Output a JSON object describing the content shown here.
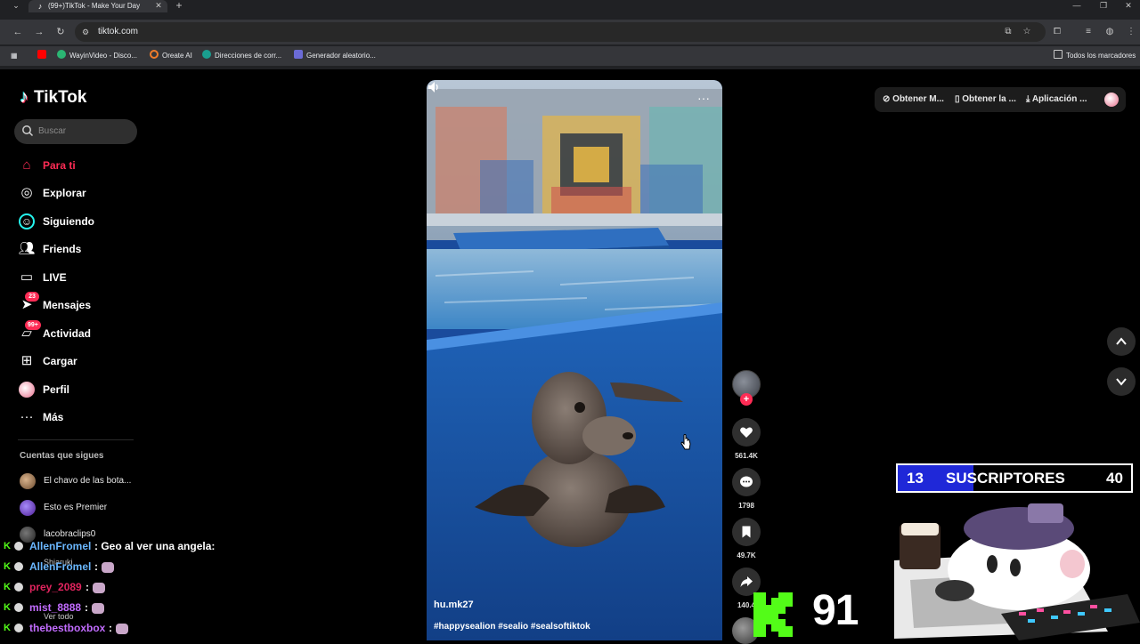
{
  "browser": {
    "tab_title": "(99+)TikTok - Make Your Day",
    "url": "tiktok.com",
    "bookmarks": [
      "WayinVideo - Disco...",
      "Oreate AI",
      "Direcciones de corr...",
      "Generador aleatorio..."
    ],
    "all_bookmarks": "Todos los marcadores"
  },
  "tiktok": {
    "logo": "TikTok",
    "search_placeholder": "Buscar",
    "nav": [
      {
        "label": "Para ti",
        "icon": "home-icon",
        "active": true
      },
      {
        "label": "Explorar",
        "icon": "compass-icon"
      },
      {
        "label": "Siguiendo",
        "icon": "following-icon"
      },
      {
        "label": "Friends",
        "icon": "friends-icon"
      },
      {
        "label": "LIVE",
        "icon": "live-icon"
      },
      {
        "label": "Mensajes",
        "icon": "messages-icon",
        "badge": "23"
      },
      {
        "label": "Actividad",
        "icon": "activity-icon",
        "badge": "99+"
      },
      {
        "label": "Cargar",
        "icon": "upload-icon"
      },
      {
        "label": "Perfil",
        "icon": "profile-icon"
      },
      {
        "label": "Más",
        "icon": "more-icon"
      }
    ],
    "following_title": "Cuentas que sigues",
    "following": [
      "El chavo de las bota...",
      "Esto es Premier",
      "lacobraclips0"
    ],
    "under_overlay": [
      "Shiaruki",
      "Ver todo"
    ],
    "video": {
      "author": "hu.mk27",
      "description": "#happysealion #sealio #sealsoftiktok"
    },
    "actions": {
      "likes": "561.4K",
      "comments": "1798",
      "saves": "49.7K",
      "shares": "140.4"
    },
    "top_actions": [
      "Obtener M...",
      "Obtener la ...",
      "Aplicación ..."
    ]
  },
  "stream": {
    "subs": {
      "current": "13",
      "label": "SUSCRIPTORES",
      "goal": "40",
      "progress": 0.325
    },
    "kick_count": "91",
    "chat": [
      {
        "user": "AllenFromel",
        "color": "#6ab7ff",
        "msg": ": Geo al ver una angela:"
      },
      {
        "user": "AllenFromel",
        "color": "#6ab7ff",
        "msg": ":"
      },
      {
        "user": "prey_2089",
        "color": "#e0245e",
        "msg": ":"
      },
      {
        "user": "mist_8888",
        "color": "#c26cff",
        "msg": ":"
      },
      {
        "user": "thebestboxbox",
        "color": "#c26cff",
        "msg": ":"
      }
    ]
  },
  "colors": {
    "accent": "#fe2c55",
    "kick_green": "#53fc18",
    "subs_blue": "#1f28d8"
  }
}
